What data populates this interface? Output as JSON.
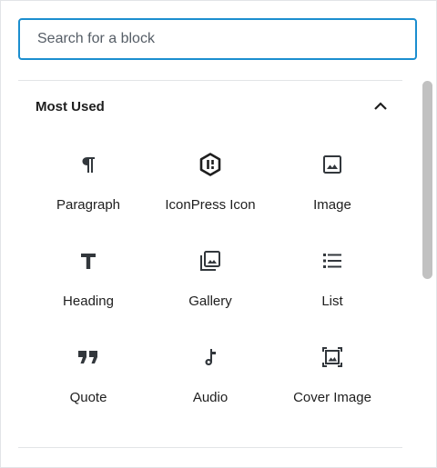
{
  "search": {
    "placeholder": "Search for a block",
    "value": ""
  },
  "section": {
    "title": "Most Used",
    "expanded": true,
    "toggle_icon": "chevron-up-icon"
  },
  "blocks": [
    {
      "label": "Paragraph",
      "icon": "paragraph-icon"
    },
    {
      "label": "IconPress Icon",
      "icon": "iconpress-icon"
    },
    {
      "label": "Image",
      "icon": "image-icon"
    },
    {
      "label": "Heading",
      "icon": "heading-icon"
    },
    {
      "label": "Gallery",
      "icon": "gallery-icon"
    },
    {
      "label": "List",
      "icon": "list-icon"
    },
    {
      "label": "Quote",
      "icon": "quote-icon"
    },
    {
      "label": "Audio",
      "icon": "audio-icon"
    },
    {
      "label": "Cover Image",
      "icon": "cover-image-icon"
    }
  ],
  "colors": {
    "focus_border": "#1b8ecf",
    "text": "#1e1e1e",
    "divider": "#e2e4e7",
    "icon": "#32373c"
  }
}
